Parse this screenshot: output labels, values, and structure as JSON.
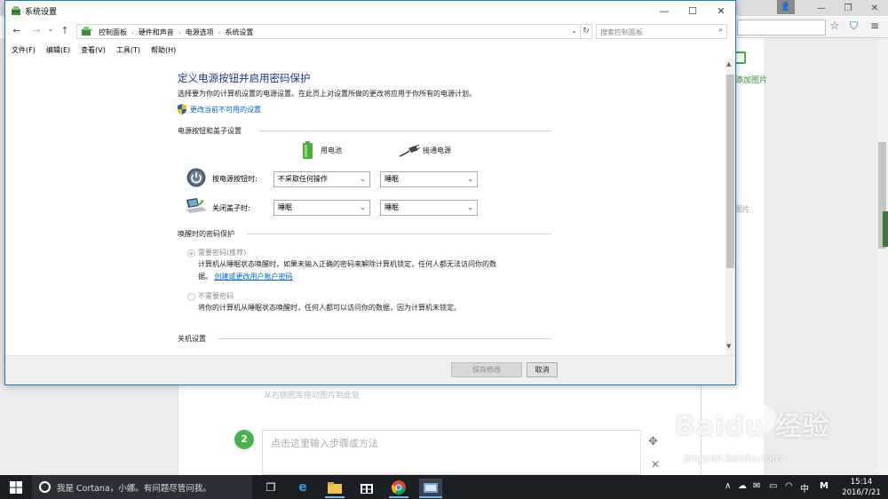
{
  "window": {
    "title": "系统设置",
    "minimize": "—",
    "maximize": "☐",
    "close": "✕"
  },
  "nav": {
    "back": "←",
    "forward": "→",
    "down": "⌄",
    "up": "↑",
    "breadcrumbs": [
      "控制面板",
      "硬件和声音",
      "电源选项",
      "系统设置"
    ],
    "search_placeholder": "搜索控制面板"
  },
  "menu": [
    "文件(F)",
    "编辑(E)",
    "查看(V)",
    "工具(T)",
    "帮助(H)"
  ],
  "page": {
    "heading": "定义电源按钮并启用密码保护",
    "description": "选择要为你的计算机设置的电源设置。在此页上对设置所做的更改将应用于你所有的电源计划。",
    "change_settings_link": "更改当前不可用的设置",
    "section_buttons": "电源按钮和盖子设置",
    "col_battery": "用电池",
    "col_plugged": "接通电源",
    "rows": [
      {
        "label": "按电源按钮时:",
        "battery": "不采取任何操作",
        "plugged": "睡眠"
      },
      {
        "label": "关闭盖子时:",
        "battery": "睡眠",
        "plugged": "睡眠"
      }
    ],
    "section_password": "唤醒时的密码保护",
    "require_label": "需要密码(推荐)",
    "require_desc_1": "计算机从睡眠状态唤醒时，如果未输入正确的密码来解除计算机锁定，任何人都无法访问你的数",
    "require_desc_2": "据。",
    "require_link": "创建或更改用户帐户密码",
    "no_require_label": "不需要密码",
    "no_require_desc": "将你的计算机从睡眠状态唤醒时，任何人都可以访问你的数据，因为计算机未锁定。",
    "section_shutdown": "关机设置"
  },
  "footer": {
    "save": "保存修改",
    "cancel": "取消"
  },
  "background": {
    "add_picture": "添加图片",
    "side_picture": "图片",
    "drag_hint": "从右侧图库拖动图片到此处",
    "step_number": "2",
    "step_placeholder": "点击这里输入步骤或方法",
    "watermark": "Baidu 经验",
    "watermark_url": "jingyan.baidu.com"
  },
  "taskbar": {
    "cortana_text": "我是 Cortana，小娜。有问题尽管问我。",
    "ime": "中",
    "ime_mode": "M",
    "time": "15:14",
    "date": "2016/7/21"
  },
  "colors": {
    "accent": "#1979ca",
    "heading": "#1e3287",
    "link": "#0066cc",
    "taskbar": "#1a1f24"
  }
}
